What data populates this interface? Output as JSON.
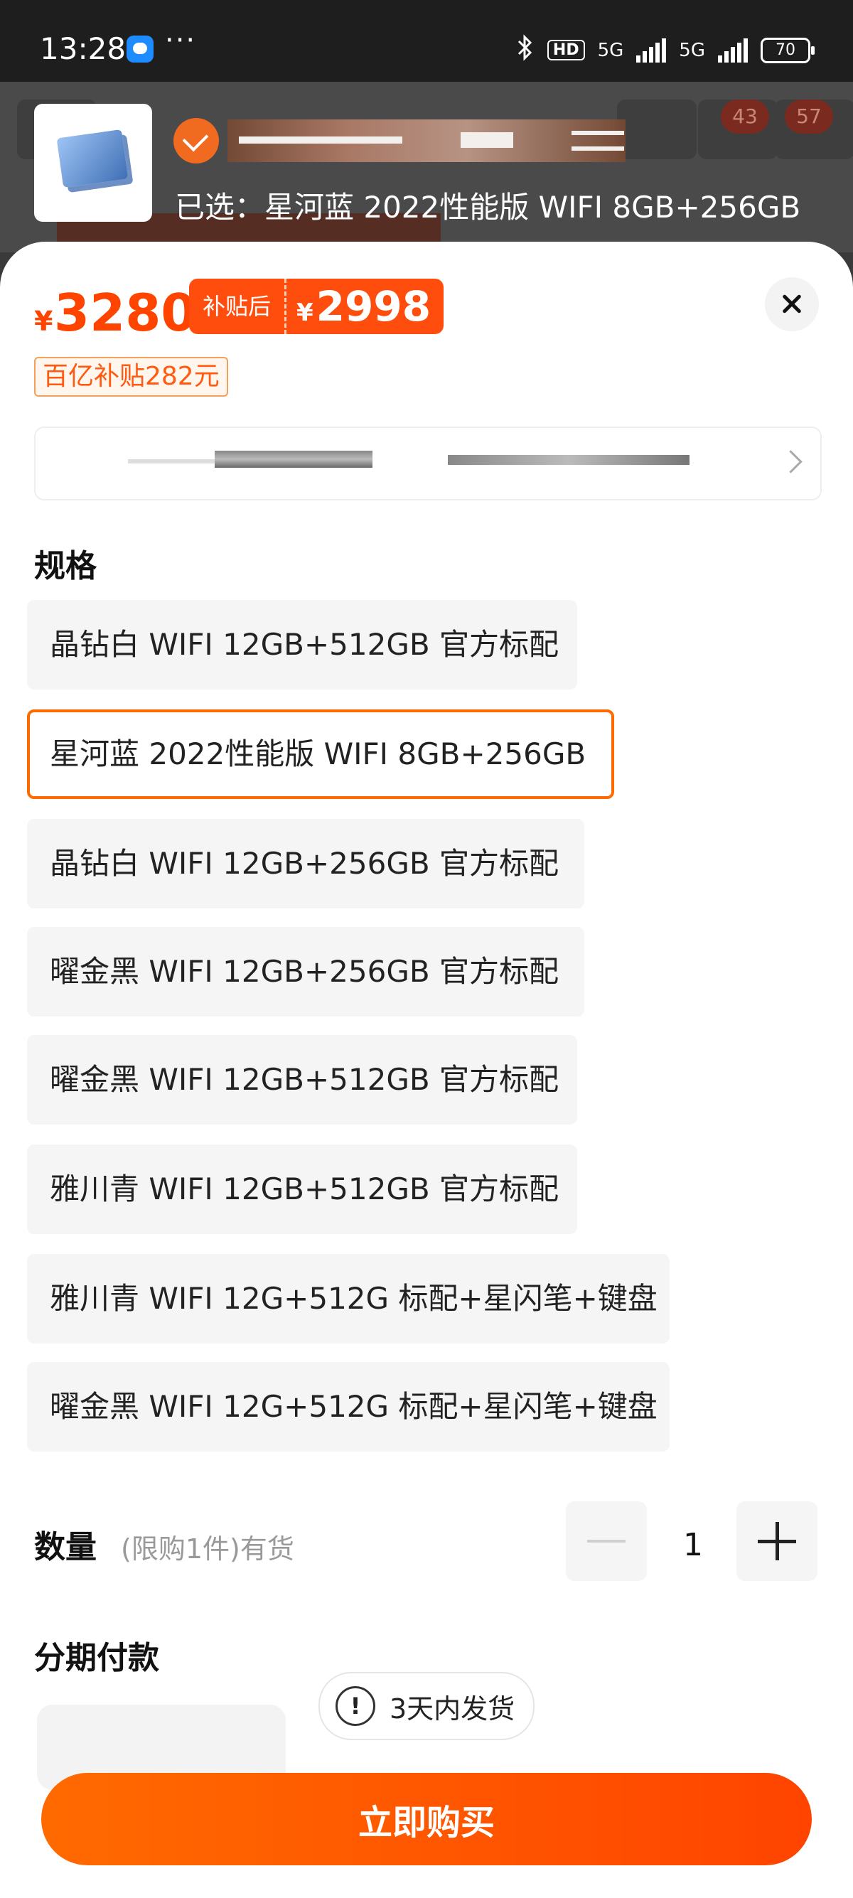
{
  "status_bar": {
    "time": "13:28",
    "dots": "···",
    "hd_label": "HD",
    "network_1": "5G",
    "network_2": "5G",
    "battery": "70"
  },
  "background": {
    "badge_cart": "43",
    "badge_other": "57"
  },
  "header": {
    "selected_label": "已选：星河蓝 2022性能版 WIFI 8GB+256GB"
  },
  "price": {
    "currency": "¥",
    "original": "3280",
    "subsidy_label": "补贴后",
    "after_currency": "¥",
    "after_subsidy": "2998",
    "coupon": "百亿补贴282元"
  },
  "spec": {
    "title": "规格",
    "selected_index": 1,
    "options": [
      "晶钻白 WIFI 12GB+512GB 官方标配",
      "星河蓝 2022性能版 WIFI 8GB+256GB",
      "晶钻白 WIFI 12GB+256GB 官方标配",
      "曜金黑 WIFI 12GB+256GB 官方标配",
      "曜金黑 WIFI 12GB+512GB 官方标配",
      "雅川青 WIFI 12GB+512GB 官方标配",
      "雅川青 WIFI 12G+512G 标配+星闪笔+键盘",
      "曜金黑 WIFI 12G+512G 标配+星闪笔+键盘"
    ]
  },
  "quantity": {
    "title": "数量",
    "note": "(限购1件)有货",
    "value": "1"
  },
  "installment": {
    "title": "分期付款"
  },
  "shipping_badge": "3天内发货",
  "buy_button": "立即购买",
  "colors": {
    "accent": "#ff4400",
    "selected_border": "#ff6a00"
  }
}
